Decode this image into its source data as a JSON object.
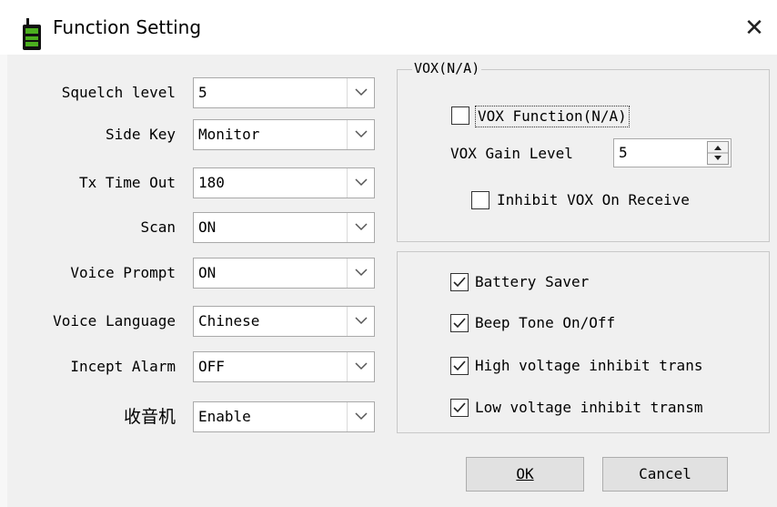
{
  "window": {
    "title": "Function Setting"
  },
  "fields": [
    {
      "label": "Squelch level",
      "value": "5"
    },
    {
      "label": "Side Key",
      "value": "Monitor"
    },
    {
      "label": "Tx Time Out",
      "value": "180"
    },
    {
      "label": "Scan",
      "value": "ON"
    },
    {
      "label": "Voice Prompt",
      "value": "ON"
    },
    {
      "label": "Voice Language",
      "value": "Chinese"
    },
    {
      "label": "Incept Alarm",
      "value": "OFF"
    },
    {
      "label": "收音机",
      "value": "Enable"
    }
  ],
  "vox": {
    "title": "VOX(N/A)",
    "function_label": "VOX Function(N/A)",
    "function_checked": false,
    "gain_label": "VOX Gain Level",
    "gain_value": "5",
    "inhibit_label": "Inhibit VOX On Receive",
    "inhibit_checked": false
  },
  "options": [
    {
      "label": "Battery Saver",
      "checked": true
    },
    {
      "label": "Beep Tone On/Off",
      "checked": true
    },
    {
      "label": "High voltage inhibit trans",
      "checked": true
    },
    {
      "label": "Low voltage inhibit transm",
      "checked": true
    }
  ],
  "buttons": {
    "ok": "OK",
    "cancel": "Cancel"
  }
}
